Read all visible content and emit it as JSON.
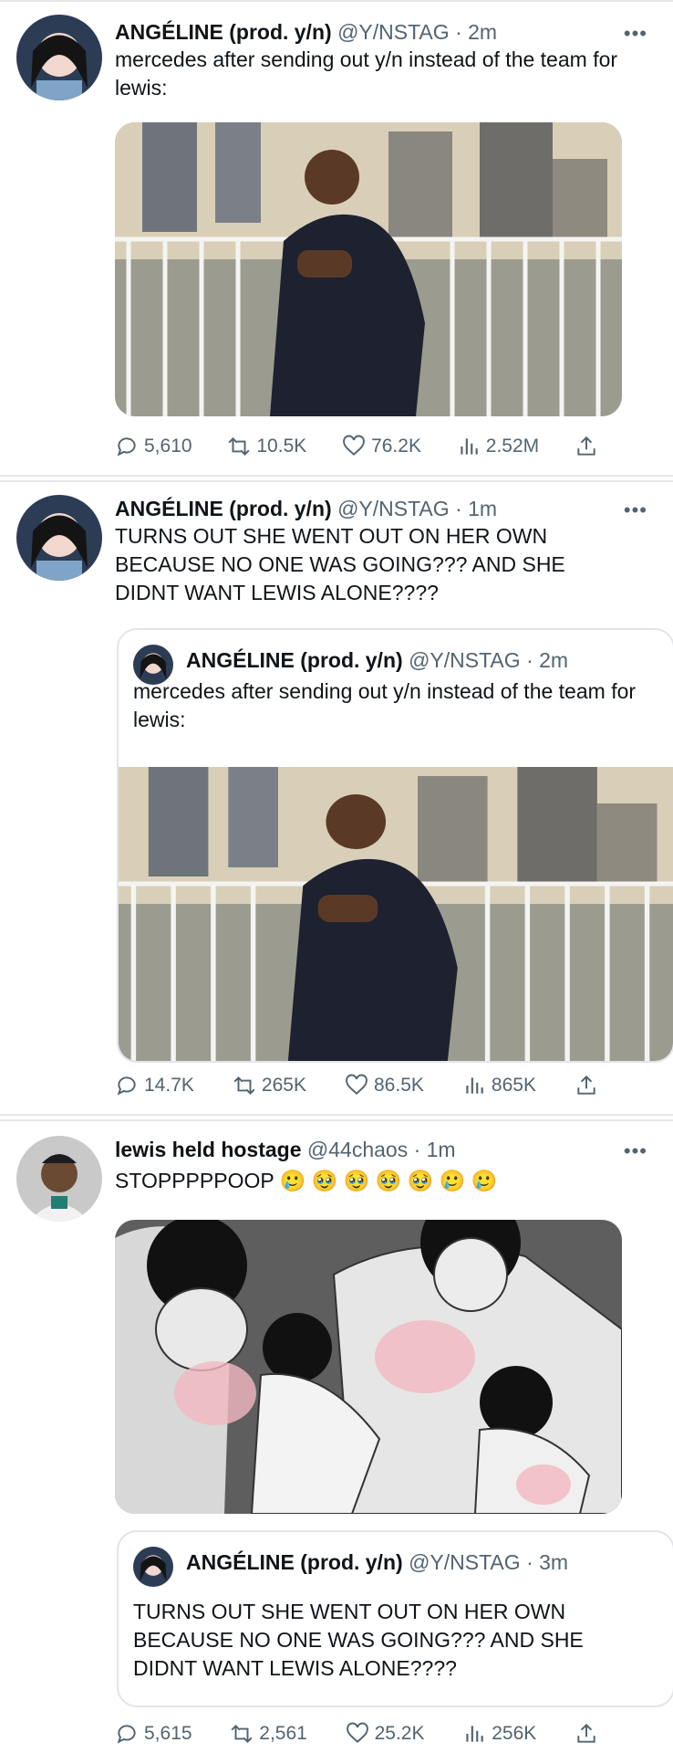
{
  "tweets": [
    {
      "author_name": "ANGÉLINE (prod. y/n)",
      "handle": "@Y/NSTAG",
      "time": "· 2m",
      "text": "mercedes after sending out y/n instead of the team for lewis:",
      "more": "•••",
      "actions": {
        "replies": "5,610",
        "retweets": "10.5K",
        "likes": "76.2K",
        "views": "2.52M"
      }
    },
    {
      "author_name": "ANGÉLINE (prod. y/n)",
      "handle": "@Y/NSTAG",
      "time": "· 1m",
      "text": "TURNS OUT SHE WENT OUT ON HER OWN BECAUSE NO ONE WAS GOING??? AND SHE DIDNT WANT LEWIS ALONE????",
      "more": "•••",
      "quote": {
        "author_name": "ANGÉLINE (prod. y/n)",
        "handle": "@Y/NSTAG",
        "time": "· 2m",
        "text": "mercedes after sending out y/n instead of the team for lewis:"
      },
      "actions": {
        "replies": "14.7K",
        "retweets": "265K",
        "likes": "86.5K",
        "views": "865K"
      }
    },
    {
      "author_name": "lewis held hostage",
      "handle": "@44chaos",
      "time": "· 1m",
      "text": "STOPPPPPOOP 🥲 🥹 🥹 🥹 🥹 🥲 🥲",
      "more": "•••",
      "quote": {
        "author_name": "ANGÉLINE (prod. y/n)",
        "handle": "@Y/NSTAG",
        "time": "· 3m",
        "text": "TURNS OUT SHE WENT OUT ON HER OWN BECAUSE NO ONE WAS GOING??? AND SHE DIDNT WANT LEWIS ALONE????"
      },
      "actions": {
        "replies": "5,615",
        "retweets": "2,561",
        "likes": "25.2K",
        "views": "256K"
      }
    }
  ]
}
